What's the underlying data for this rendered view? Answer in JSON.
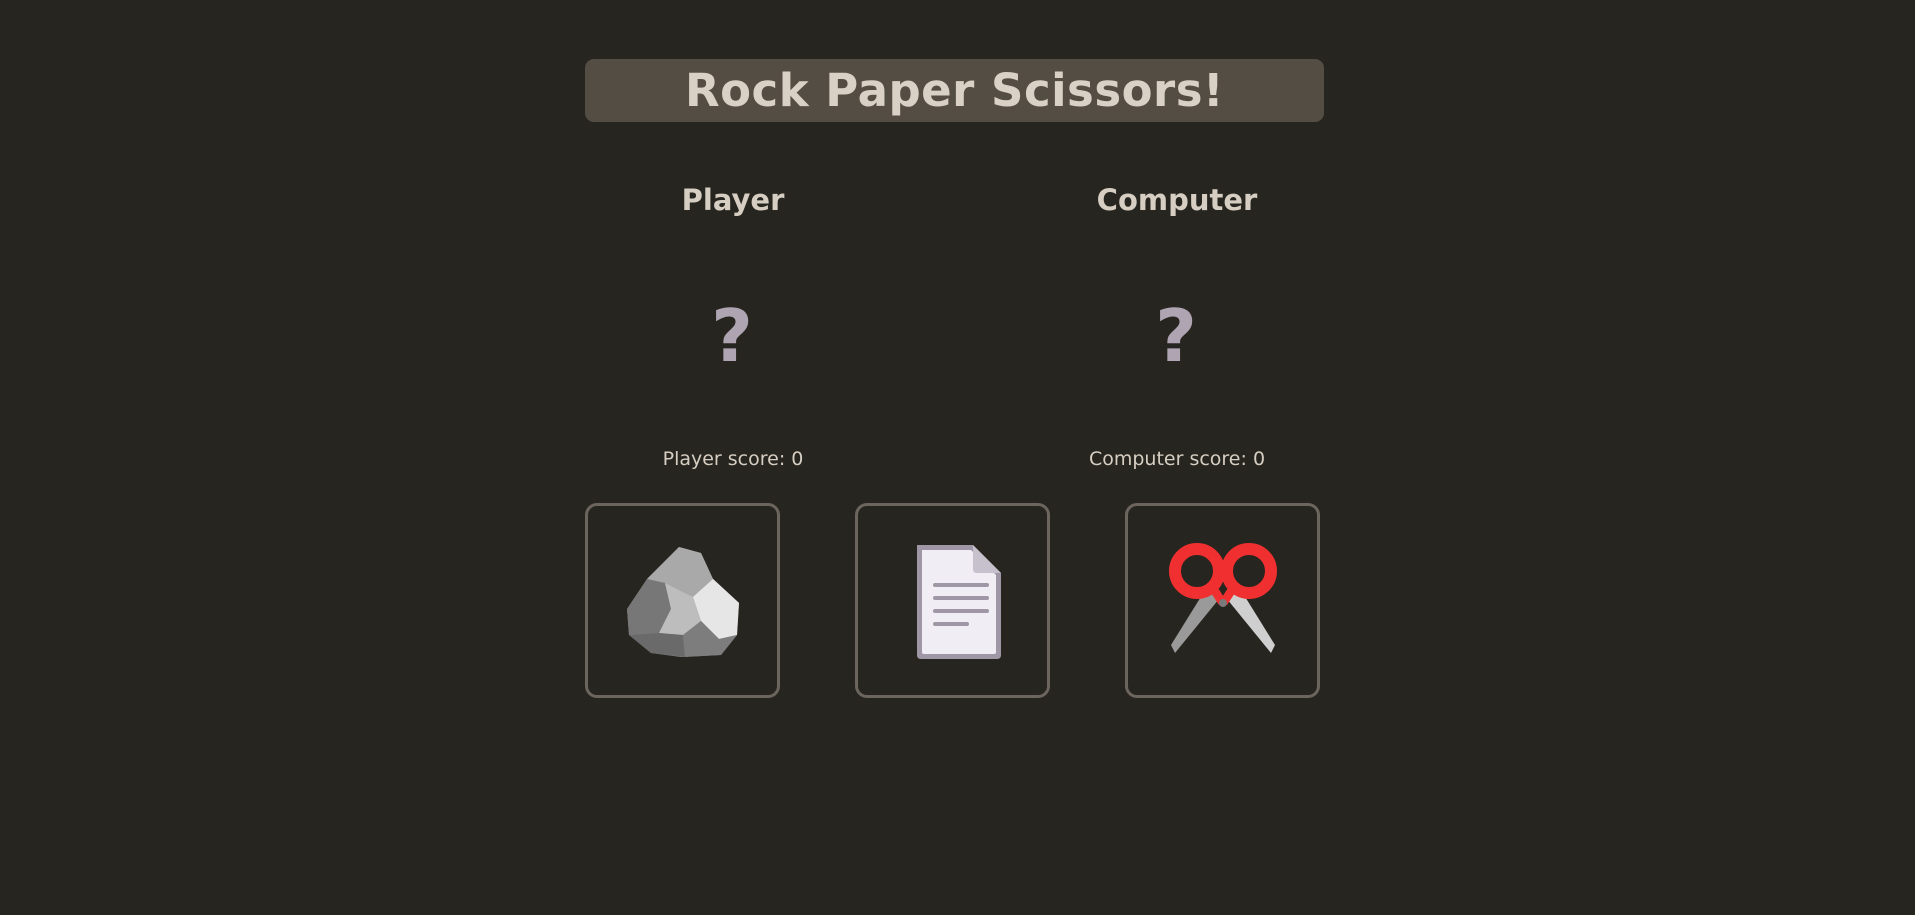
{
  "title": "Rock Paper Scissors!",
  "player": {
    "label": "Player",
    "choice": "?",
    "score_label": "Player score: ",
    "score": "0"
  },
  "computer": {
    "label": "Computer",
    "choice": "?",
    "score_label": "Computer score: ",
    "score": "0"
  },
  "choices": [
    {
      "name": "rock",
      "icon": "rock-icon"
    },
    {
      "name": "paper",
      "icon": "paper-icon"
    },
    {
      "name": "scissors",
      "icon": "scissors-icon"
    }
  ],
  "colors": {
    "background": "#27251f",
    "title_bar": "#544d44",
    "text": "#d6cec2",
    "question_mark": "#aea4b2",
    "button_border": "#6b655d",
    "scissors_handle": "#f03030"
  }
}
